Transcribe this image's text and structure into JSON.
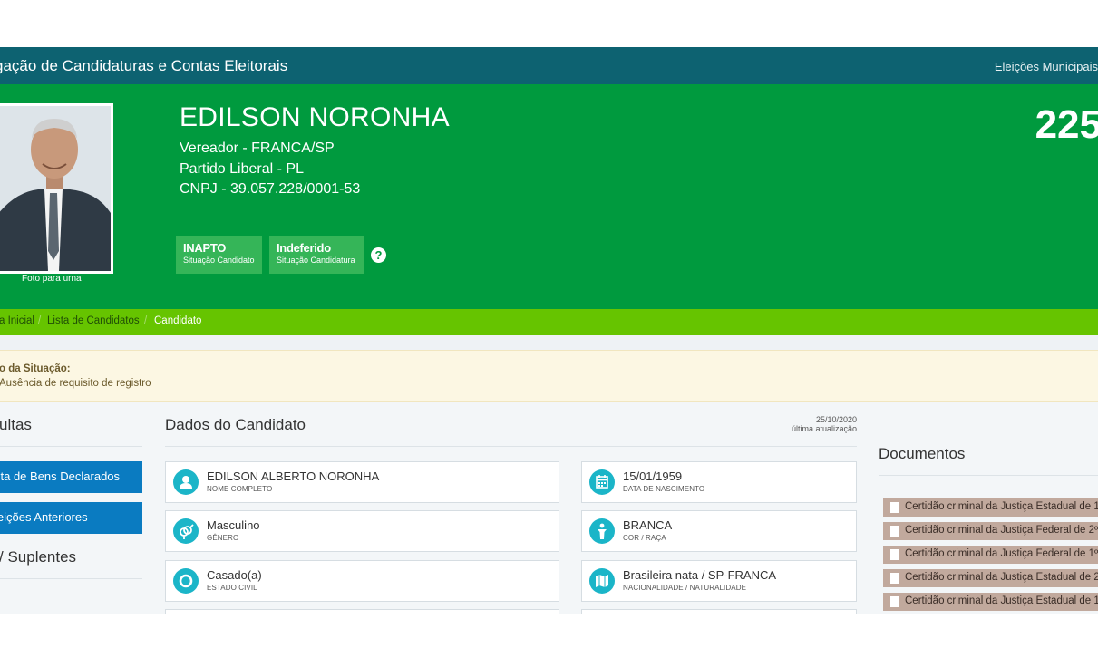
{
  "header": {
    "title": "gação de Candidaturas e Contas Eleitorais",
    "election": "Eleições Municipais"
  },
  "candidate": {
    "name": "EDILSON NORONHA",
    "role": "Vereador - FRANCA/SP",
    "party": "Partido Liberal - PL",
    "cnpj": "CNPJ - 39.057.228/0001-53",
    "number": "225",
    "photo_caption": "Foto para urna",
    "status_candidate": {
      "value": "INAPTO",
      "label": "Situação Candidato"
    },
    "status_candidacy": {
      "value": "Indeferido",
      "label": "Situação Candidatura"
    },
    "help_glyph": "?"
  },
  "breadcrumb": {
    "home": "a Inicial",
    "list": "Lista de Candidatos",
    "current": "Candidato",
    "separator": "/"
  },
  "notice": {
    "title": "o da Situação:",
    "text": "Ausência de requisito de registro"
  },
  "sidebar": {
    "heading": "ultas",
    "buttons": [
      "sta de Bens Declarados",
      "leições Anteriores"
    ],
    "suplentes": "/ Suplentes"
  },
  "details": {
    "heading": "Dados do Candidato",
    "updated_date": "25/10/2020",
    "updated_label": "última atualização",
    "cards": [
      {
        "value": "EDILSON ALBERTO NORONHA",
        "label": "NOME COMPLETO",
        "icon": "user-icon"
      },
      {
        "value": "15/01/1959",
        "label": "DATA DE NASCIMENTO",
        "icon": "calendar-icon"
      },
      {
        "value": "Masculino",
        "label": "GÊNERO",
        "icon": "gender-icon"
      },
      {
        "value": "BRANCA",
        "label": "COR / RAÇA",
        "icon": "person-icon"
      },
      {
        "value": "Casado(a)",
        "label": "ESTADO CIVIL",
        "icon": "ring-icon"
      },
      {
        "value": "Brasileira nata / SP-FRANCA",
        "label": "NACIONALIDADE / NATURALIDADE",
        "icon": "map-icon"
      }
    ]
  },
  "documents": {
    "heading": "Documentos",
    "items": [
      "Certidão criminal da Justiça Estadual de 1",
      "Certidão criminal da Justiça Federal de 2º",
      "Certidão criminal da Justiça Federal de 1º",
      "Certidão criminal da Justiça Estadual de 2",
      "Certidão criminal da Justiça Estadual de 1"
    ]
  },
  "colors": {
    "topbar": "#0d6271",
    "hero": "#009a3e",
    "breadcrumb_bar": "#66c400",
    "badge": "#35b558",
    "sidebar_button": "#0a7bc1",
    "card_icon": "#1bb5c8",
    "document_item": "#c1a99d",
    "notice_bg": "#fcf7e3"
  }
}
